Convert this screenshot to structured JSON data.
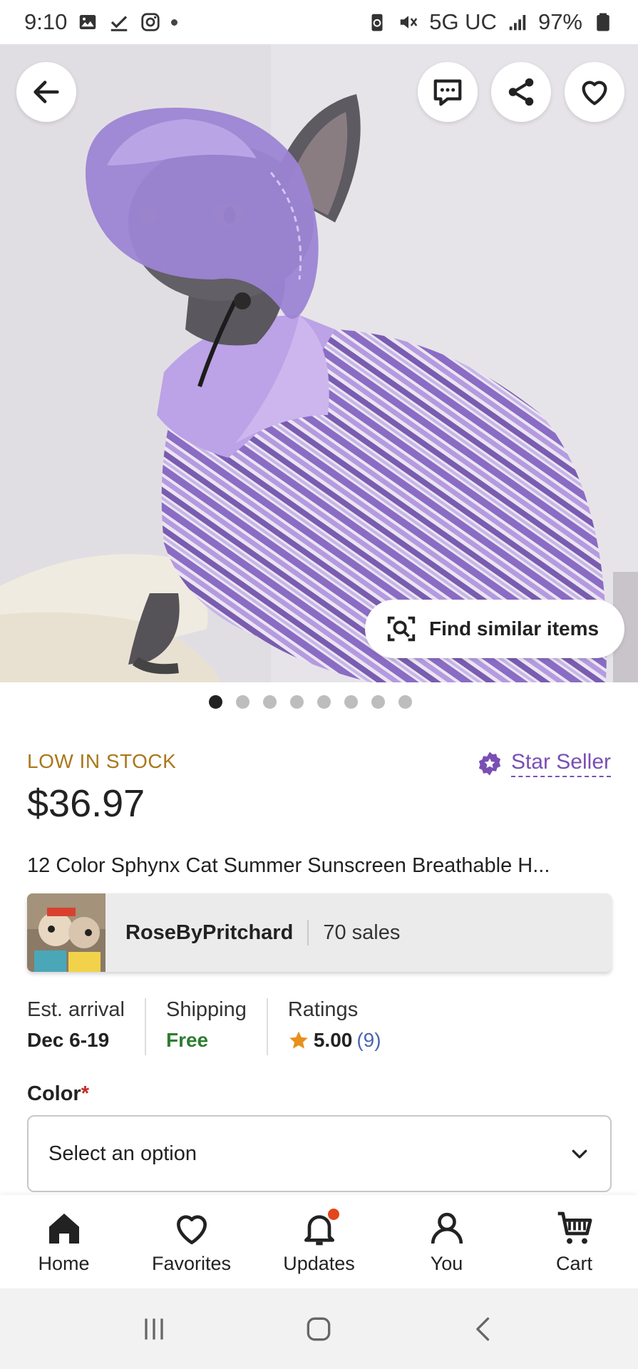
{
  "status_bar": {
    "time": "9:10",
    "left_icons": [
      "gallery-icon",
      "check-icon",
      "instagram-icon",
      "dot-icon"
    ],
    "network": "5G UC",
    "battery": "97%"
  },
  "hero": {
    "image_subject": "sphynx cat wearing purple bucket hat and purple-white striped polo shirt",
    "find_similar_label": "Find similar items",
    "page_count": 8,
    "active_page": 0
  },
  "product": {
    "stock_status": "LOW IN STOCK",
    "star_seller_label": "Star Seller",
    "price": "$36.97",
    "title": "12 Color Sphynx Cat Summer Sunscreen Breathable H..."
  },
  "shop": {
    "name": "RoseByPritchard",
    "sales": "70 sales"
  },
  "info": {
    "arrival_label": "Est. arrival",
    "arrival_value": "Dec 6-19",
    "shipping_label": "Shipping",
    "shipping_value": "Free",
    "ratings_label": "Ratings",
    "rating_value": "5.00",
    "rating_count": "(9)"
  },
  "variation": {
    "label": "Color",
    "required_mark": "*",
    "placeholder": "Select an option"
  },
  "bottom_nav": {
    "items": [
      {
        "label": "Home",
        "icon": "home-icon"
      },
      {
        "label": "Favorites",
        "icon": "heart-icon"
      },
      {
        "label": "Updates",
        "icon": "bell-icon"
      },
      {
        "label": "You",
        "icon": "person-icon"
      },
      {
        "label": "Cart",
        "icon": "cart-icon"
      }
    ]
  },
  "colors": {
    "stock": "#a9771a",
    "star_seller": "#7a4fb4",
    "free": "#2e7d32",
    "rating_count": "#4a66b0",
    "star": "#e8901c",
    "badge": "#e3461c"
  }
}
